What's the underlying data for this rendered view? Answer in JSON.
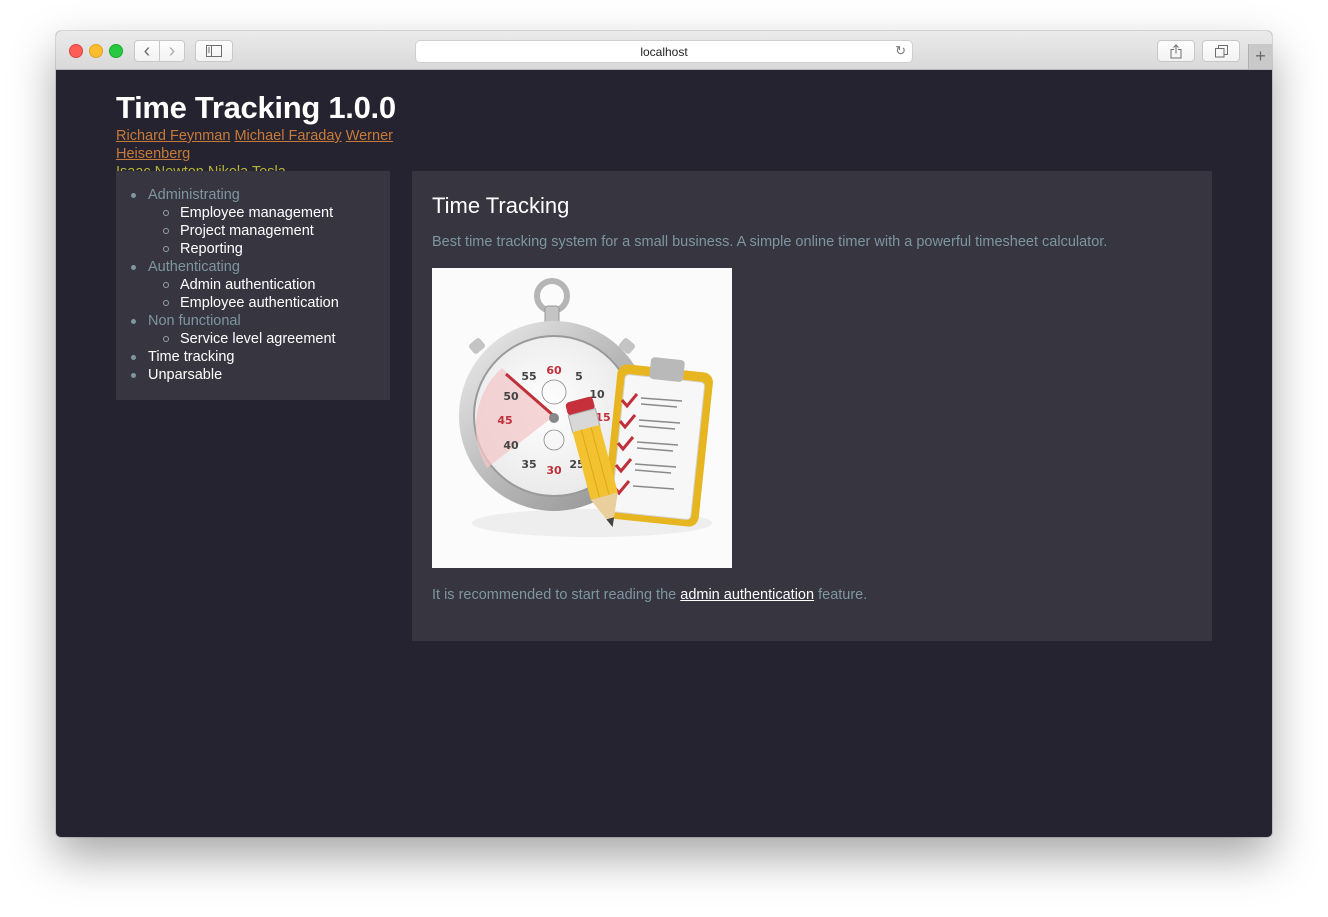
{
  "browser": {
    "url": "localhost",
    "icons": {
      "back": "chevron-left-icon",
      "forward": "chevron-right-icon",
      "sidebar": "sidebar-icon",
      "reload": "reload-icon",
      "share": "share-icon",
      "tabs": "tabs-overview-icon",
      "new_tab": "plus-icon"
    },
    "glyphs": {
      "back": "‹",
      "forward": "›",
      "reload": "↻",
      "new_tab": "+"
    }
  },
  "header": {
    "title": "Time Tracking 1.0.0",
    "authors": [
      {
        "name": "Richard Feynman",
        "color": "#c77a3a"
      },
      {
        "name": "Michael Faraday",
        "color": "#c77a3a"
      },
      {
        "name": "Werner Heisenberg",
        "color": "#c77a3a"
      },
      {
        "name": "Isaac Newton",
        "color": "#b5b33a"
      },
      {
        "name": "Nikola Tesla",
        "color": "#b5b33a"
      }
    ]
  },
  "sidebar": {
    "sections": [
      {
        "label": "Administrating",
        "items": [
          "Employee management",
          "Project management",
          "Reporting"
        ]
      },
      {
        "label": "Authenticating",
        "items": [
          "Admin authentication",
          "Employee authentication"
        ]
      },
      {
        "label": "Non functional",
        "items": [
          "Service level agreement"
        ]
      }
    ],
    "leaves": [
      "Time tracking",
      "Unparsable"
    ]
  },
  "main": {
    "title": "Time Tracking",
    "description": "Best time tracking system for a small business. A simple online timer with a powerful timesheet calculator.",
    "image_alt": "stopwatch-and-clipboard-illustration",
    "stopwatch_labels": [
      "60",
      "5",
      "10",
      "15",
      "25",
      "30",
      "35",
      "40",
      "45",
      "50",
      "55"
    ],
    "note_prefix": "It is recommended to start reading the ",
    "note_link": "admin authentication",
    "note_suffix": " feature."
  },
  "colors": {
    "page_bg": "#24232f",
    "panel_bg": "#363540",
    "muted_text": "#7e96a0",
    "link_orange": "#c77a3a",
    "link_olive": "#b5b33a"
  }
}
